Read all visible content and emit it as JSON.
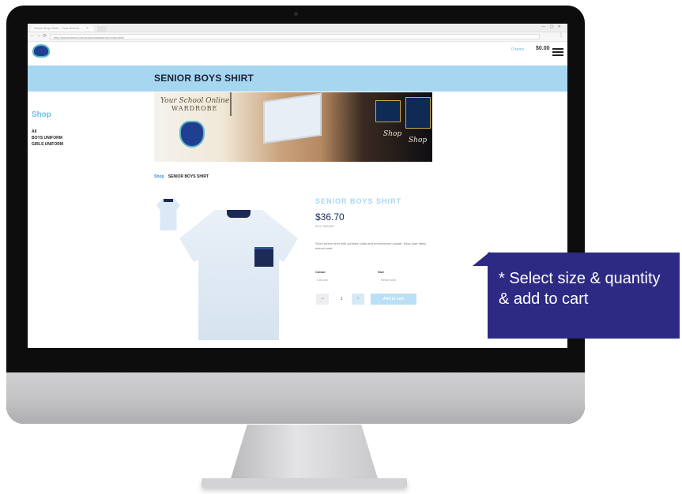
{
  "browser": {
    "tab_title": "Senior Boys Shirt – Your School",
    "tab_close": "×",
    "url": "http://yourschool.com.au/product/senior-boys-shirt",
    "window_controls": "— ▢ ✕"
  },
  "header": {
    "cart_link": "0 items",
    "cart_total": "$0.00"
  },
  "banner": {
    "title": "SENIOR BOYS SHIRT"
  },
  "sidebar": {
    "title": "Shop",
    "items": [
      "All",
      "BOYS UNIFORM",
      "GIRLS UNIFORM"
    ]
  },
  "promo": {
    "script_text": "Your School Online",
    "wardrobe": "WARDROBE",
    "shop1": "Shop",
    "shop2": "Shop"
  },
  "breadcrumb": {
    "link": "Shop",
    "current": "SENIOR BOYS SHIRT"
  },
  "product": {
    "title": "SENIOR BOYS SHIRT",
    "price": "$36.70",
    "sku": "SKU: SBSHIRT",
    "description": "Short sleeve shirt with contrast collar and embroidered pocket. Easy care fabric, school crest.",
    "colour_label": "Colour",
    "colour_value": "Choose",
    "size_label": "Size",
    "size_value": "Select size",
    "qty_minus": "−",
    "qty_value": "1",
    "qty_plus": "+",
    "add_to_cart": "Add to cart"
  },
  "callout": {
    "text": "* Select size & quantity\n& add to cart"
  },
  "colors": {
    "banner": "#a6d6f0",
    "callout": "#2d2a84",
    "accent": "#6fc0e6"
  },
  "icons": {
    "back": "←",
    "forward": "→",
    "reload": "⟳",
    "menu": "⋮"
  }
}
